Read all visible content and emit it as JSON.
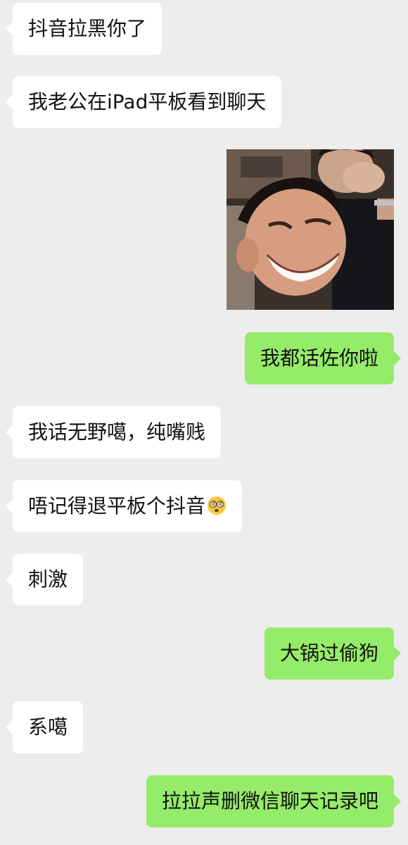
{
  "messages": [
    {
      "side": "in",
      "text": "抖音拉黑你了"
    },
    {
      "side": "in",
      "text": "我老公在iPad平板看到聊天"
    },
    {
      "side": "out",
      "type": "sticker",
      "icon": "laughing-men-photo"
    },
    {
      "side": "out",
      "text": "我都话佐你啦"
    },
    {
      "side": "in",
      "text": "我话无野噶，纯嘴贱"
    },
    {
      "side": "in",
      "text": "唔记得退平板个抖音",
      "emoji": "dizzy-face-icon"
    },
    {
      "side": "in",
      "text": "刺激"
    },
    {
      "side": "out",
      "text": "大锅过偷狗"
    },
    {
      "side": "in",
      "text": "系噶"
    },
    {
      "side": "out",
      "text": "拉拉声删微信聊天记录吧"
    }
  ],
  "colors": {
    "background": "#ededed",
    "incoming_bubble": "#ffffff",
    "outgoing_bubble": "#95ec69",
    "text": "#111111"
  }
}
